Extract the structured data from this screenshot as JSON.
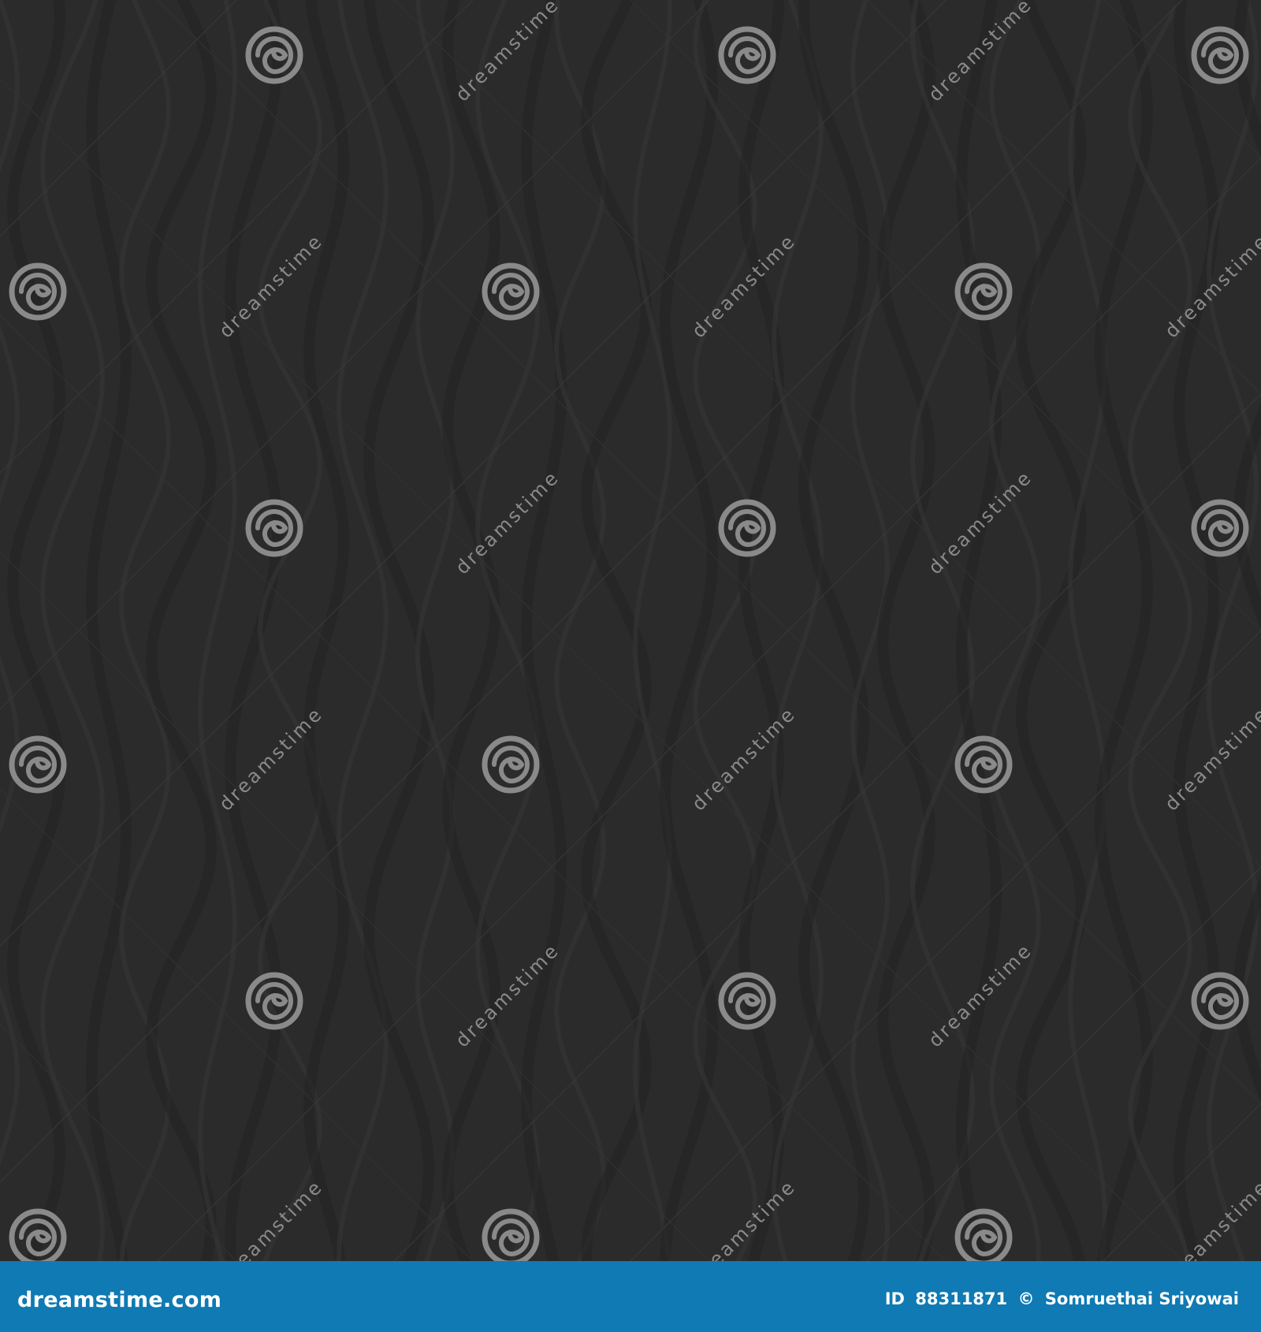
{
  "image": {
    "background_color": "#2b2b2b",
    "wave_color_dark": "#222222",
    "wave_color_light": "#363636",
    "watermark_color": "#8a8a8a"
  },
  "watermark": {
    "text": "dreamstime",
    "icon": "spiral-logo-icon"
  },
  "footer": {
    "background_color": "#0f7ab3",
    "logo_text": "dreamstime.com",
    "id_label": "ID",
    "id_value": "88311871",
    "copyright_symbol": "©",
    "author": "Somruethai Sriyowai"
  }
}
